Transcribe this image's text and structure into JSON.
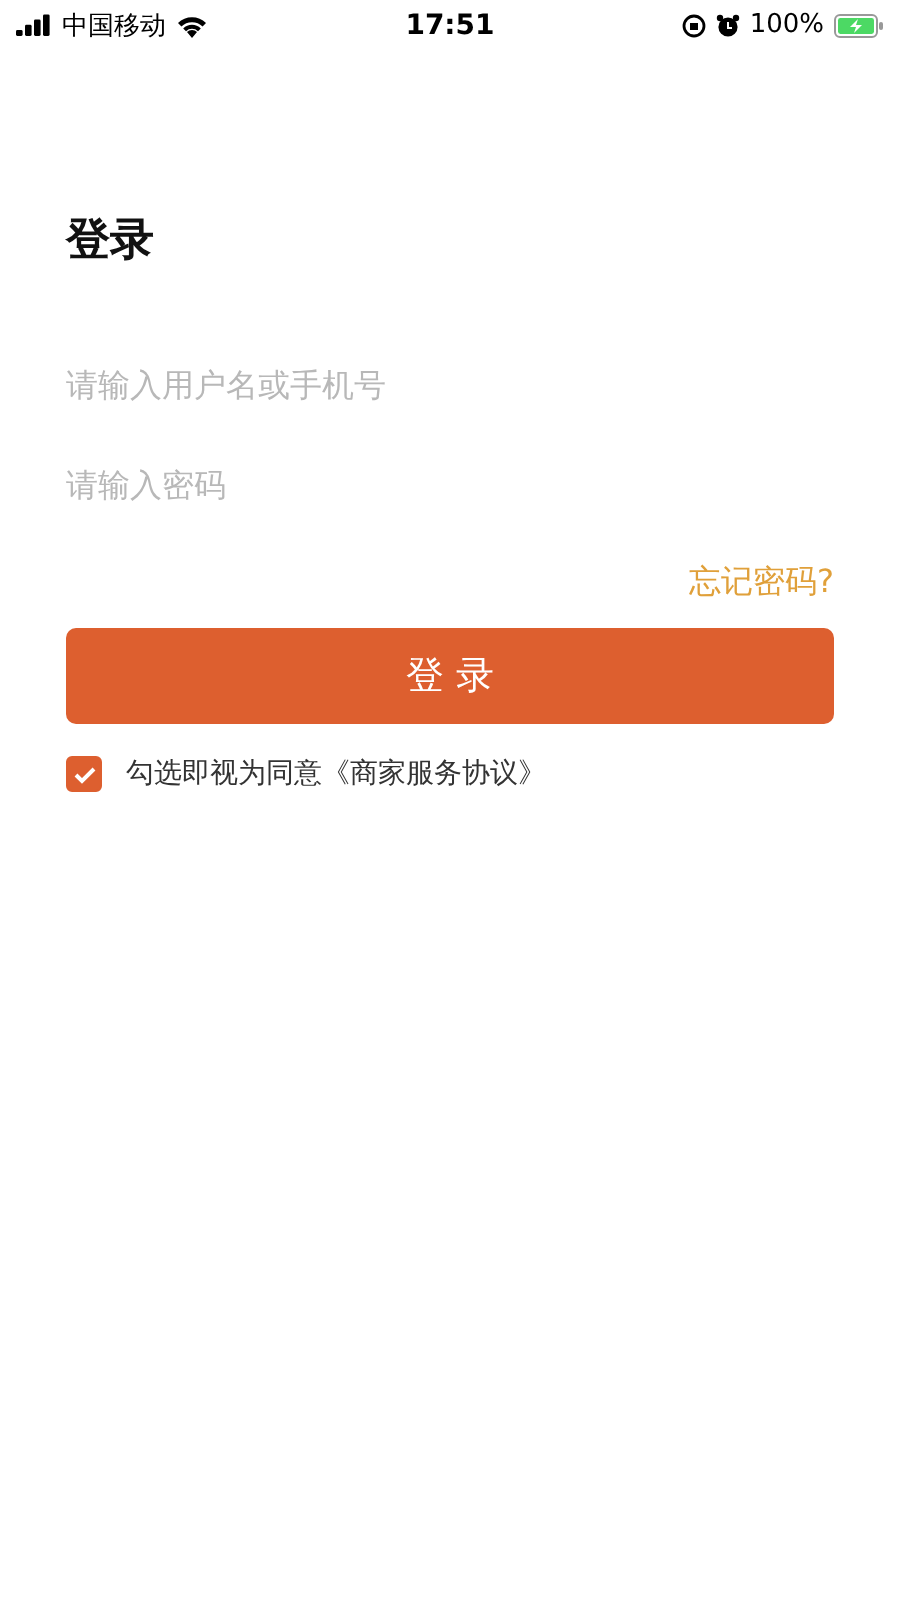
{
  "status_bar": {
    "carrier": "中国移动",
    "time": "17:51",
    "battery": "100%"
  },
  "title": "登录",
  "fields": [
    {
      "placeholder": "请输入用户名或手机号"
    },
    {
      "placeholder": "请输入密码"
    }
  ],
  "forgot_link": "忘记密码?",
  "login_button": "登 录",
  "agreement": {
    "text": "勾选即视为同意《商家服务协议》",
    "checked": true
  }
}
